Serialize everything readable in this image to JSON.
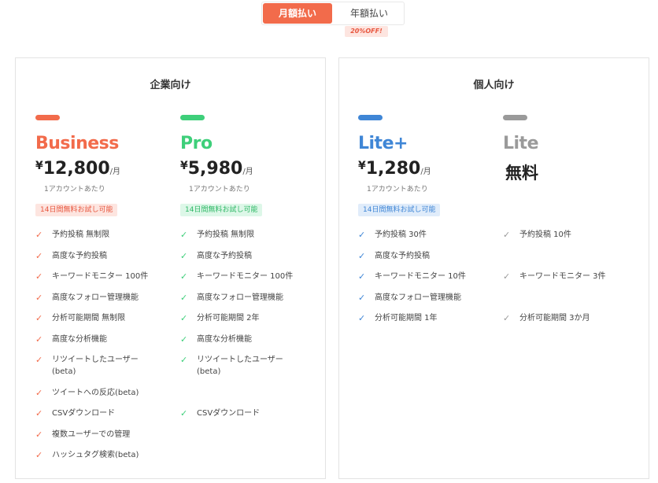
{
  "billing": {
    "monthly_label": "月額払い",
    "yearly_label": "年額払い",
    "discount_badge": "20%OFF!"
  },
  "colors": {
    "business": "#f26b4b",
    "pro": "#3ecf7a",
    "lite_plus": "#3f86d6",
    "lite": "#9a9a9a"
  },
  "sections": {
    "business_title": "企業向け",
    "personal_title": "個人向け"
  },
  "plans": {
    "business": {
      "name": "Business",
      "currency": "¥",
      "price": "12,800",
      "period": "/月",
      "note": "1アカウントあたり",
      "trial": "14日間無料お試し可能",
      "features": [
        "予約投稿 無制限",
        "高度な予約投稿",
        "キーワードモニター 100件",
        "高度なフォロー管理機能",
        "分析可能期間 無制限",
        "高度な分析機能",
        "リツイートしたユーザー(beta)",
        "ツイートへの反応(beta)",
        "CSVダウンロード",
        "複数ユーザーでの管理",
        "ハッシュタグ検索(beta)"
      ]
    },
    "pro": {
      "name": "Pro",
      "currency": "¥",
      "price": "5,980",
      "period": "/月",
      "note": "1アカウントあたり",
      "trial": "14日間無料お試し可能",
      "features": [
        "予約投稿 無制限",
        "高度な予約投稿",
        "キーワードモニター 100件",
        "高度なフォロー管理機能",
        "分析可能期間 2年",
        "高度な分析機能",
        "リツイートしたユーザー(beta)",
        "CSVダウンロード"
      ]
    },
    "lite_plus": {
      "name": "Lite+",
      "currency": "¥",
      "price": "1,280",
      "period": "/月",
      "note": "1アカウントあたり",
      "trial": "14日間無料お試し可能",
      "features": [
        "予約投稿 30件",
        "高度な予約投稿",
        "キーワードモニター 10件",
        "高度なフォロー管理機能",
        "分析可能期間 1年"
      ]
    },
    "lite": {
      "name": "Lite",
      "price_text": "無料",
      "features": [
        "予約投稿 10件",
        "キーワードモニター 3件",
        "分析可能期間 3か月"
      ]
    }
  }
}
